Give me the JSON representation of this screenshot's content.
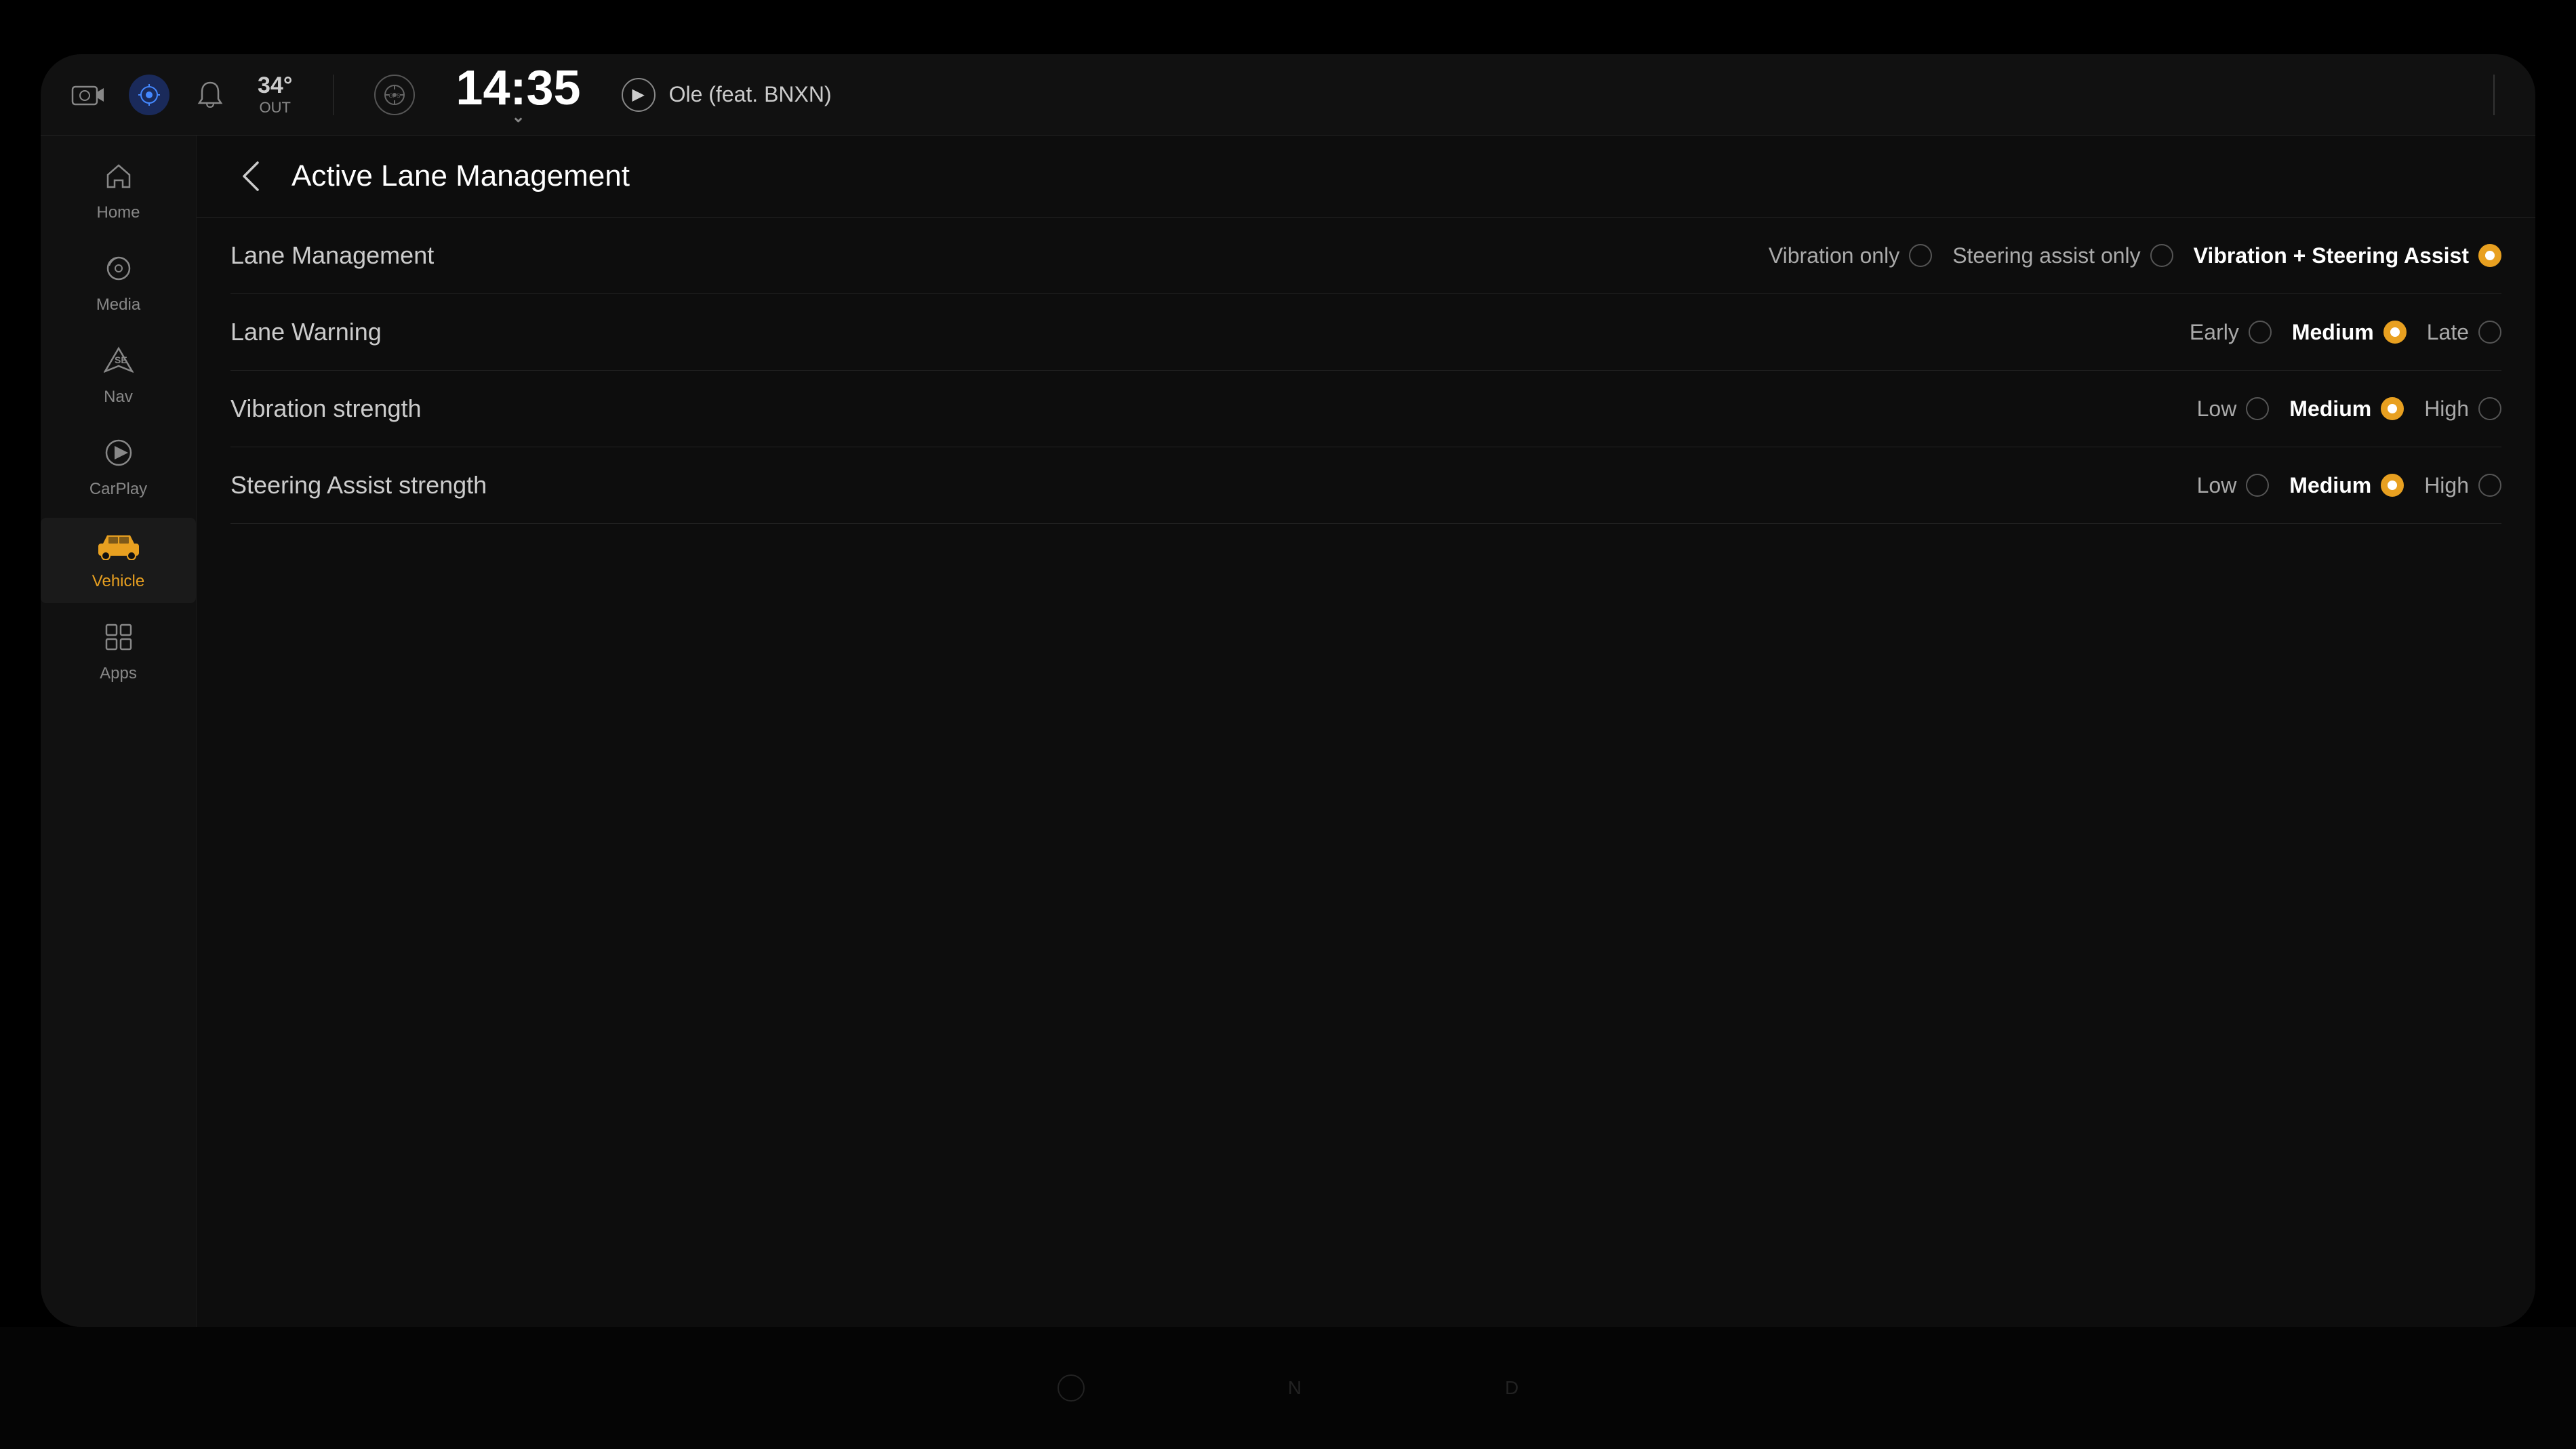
{
  "header": {
    "temperature": "34°",
    "temp_unit": "OUT",
    "time": "14:35",
    "now_playing": "Ole (feat. BNXN)",
    "gps_label": "GPS"
  },
  "sidebar": {
    "items": [
      {
        "id": "home",
        "label": "Home",
        "icon": "⌂",
        "active": false
      },
      {
        "id": "media",
        "label": "Media",
        "icon": "♪",
        "active": false
      },
      {
        "id": "nav",
        "label": "Nav",
        "icon": "▲",
        "active": false,
        "badge": "SE"
      },
      {
        "id": "carplay",
        "label": "CarPlay",
        "icon": "▶",
        "active": false
      },
      {
        "id": "vehicle",
        "label": "Vehicle",
        "icon": "🚗",
        "active": true
      },
      {
        "id": "apps",
        "label": "Apps",
        "icon": "⊞",
        "active": false
      }
    ]
  },
  "page": {
    "title": "Active Lane Management",
    "back_label": "‹"
  },
  "settings": {
    "rows": [
      {
        "id": "lane-management",
        "label": "Lane Management",
        "options": [
          {
            "id": "vibration-only",
            "label": "Vibration only",
            "selected": false
          },
          {
            "id": "steering-assist-only",
            "label": "Steering assist only",
            "selected": false
          },
          {
            "id": "vibration-steering",
            "label": "Vibration + Steering Assist",
            "selected": true
          }
        ]
      },
      {
        "id": "lane-warning",
        "label": "Lane Warning",
        "options": [
          {
            "id": "early",
            "label": "Early",
            "selected": false
          },
          {
            "id": "medium",
            "label": "Medium",
            "selected": true
          },
          {
            "id": "late",
            "label": "Late",
            "selected": false
          }
        ]
      },
      {
        "id": "vibration-strength",
        "label": "Vibration strength",
        "options": [
          {
            "id": "low",
            "label": "Low",
            "selected": false
          },
          {
            "id": "medium",
            "label": "Medium",
            "selected": true
          },
          {
            "id": "high",
            "label": "High",
            "selected": false
          }
        ]
      },
      {
        "id": "steering-assist-strength",
        "label": "Steering Assist strength",
        "options": [
          {
            "id": "low",
            "label": "Low",
            "selected": false
          },
          {
            "id": "medium",
            "label": "Medium",
            "selected": true
          },
          {
            "id": "high",
            "label": "High",
            "selected": false
          }
        ]
      }
    ]
  },
  "colors": {
    "accent": "#e8a020",
    "selected_radio": "#e8a020",
    "unselected_radio": "#555",
    "background": "#0d0d0d",
    "sidebar_bg": "#111",
    "header_bg": "#111"
  }
}
